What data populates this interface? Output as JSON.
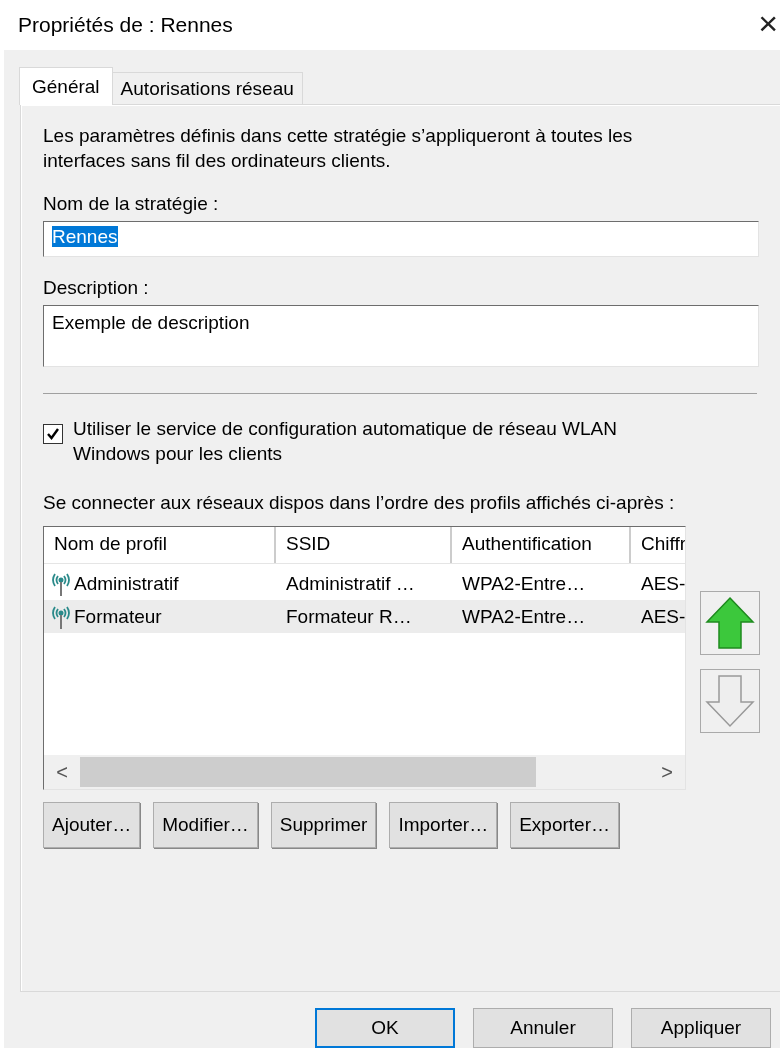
{
  "window": {
    "title": "Propriétés de : Rennes",
    "close": "×"
  },
  "tabs": [
    {
      "label": "Général",
      "selected": true
    },
    {
      "label": "Autorisations réseau",
      "selected": false
    }
  ],
  "intro": "Les paramètres définis dans cette stratégie s’appliqueront à toutes les interfaces sans fil des ordinateurs clients.",
  "policy_name": {
    "label": "Nom de la stratégie :",
    "value": "Rennes",
    "text_selected": true
  },
  "description": {
    "label": "Description :",
    "value": "Exemple de description"
  },
  "wlan_service": {
    "label": "Utiliser le service de configuration automatique de réseau WLAN Windows pour les clients",
    "checked": true
  },
  "profiles_label": "Se connecter aux réseaux dispos dans l’ordre des profils affichés ci-après :",
  "table": {
    "columns": [
      "Nom de profil",
      "SSID",
      "Authentification",
      "Chiffr"
    ],
    "rows": [
      {
        "cells": [
          "Administratif",
          "Administratif …",
          "WPA2-Entre…",
          "AES-"
        ],
        "selected": false
      },
      {
        "cells": [
          "Formateur",
          "Formateur R…",
          "WPA2-Entre…",
          "AES-"
        ],
        "selected": true
      }
    ],
    "scroll_left": "<",
    "scroll_right": ">"
  },
  "move_up": {
    "disabled": false
  },
  "move_down": {
    "disabled": true
  },
  "profile_buttons": [
    "Ajouter…",
    "Modifier…",
    "Supprimer",
    "Importer…",
    "Exporter…"
  ],
  "dialog_buttons": [
    {
      "label": "OK",
      "default": true
    },
    {
      "label": "Annuler",
      "default": false
    },
    {
      "label": "Appliquer",
      "default": false
    }
  ]
}
